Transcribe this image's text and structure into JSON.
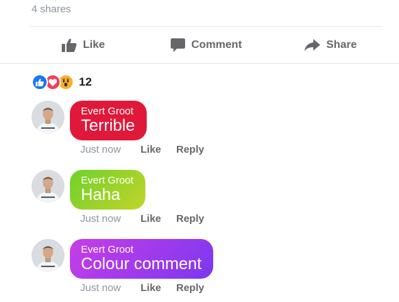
{
  "post": {
    "shares_text": "4 shares"
  },
  "actions": [
    {
      "label": "Like",
      "icon": "thumbs-up-icon"
    },
    {
      "label": "Comment",
      "icon": "speech-bubble-icon"
    },
    {
      "label": "Share",
      "icon": "share-arrow-icon"
    }
  ],
  "reactions": {
    "icons": [
      "like-reaction-icon",
      "love-reaction-icon",
      "wow-reaction-icon"
    ],
    "count": "12"
  },
  "comments": [
    {
      "author": "Evert Groot",
      "text": "Terrible",
      "time": "Just now",
      "like_label": "Like",
      "reply_label": "Reply",
      "bubble_color": "#e0183a"
    },
    {
      "author": "Evert Groot",
      "text": "Haha",
      "time": "Just now",
      "like_label": "Like",
      "reply_label": "Reply",
      "bubble_gradient": [
        "#6fd12b",
        "#c2d42a"
      ]
    },
    {
      "author": "Evert Groot",
      "text": "Colour comment",
      "time": "Just now",
      "like_label": "Like",
      "reply_label": "Reply",
      "bubble_gradient": [
        "#c93de8",
        "#7a38f0"
      ]
    }
  ]
}
